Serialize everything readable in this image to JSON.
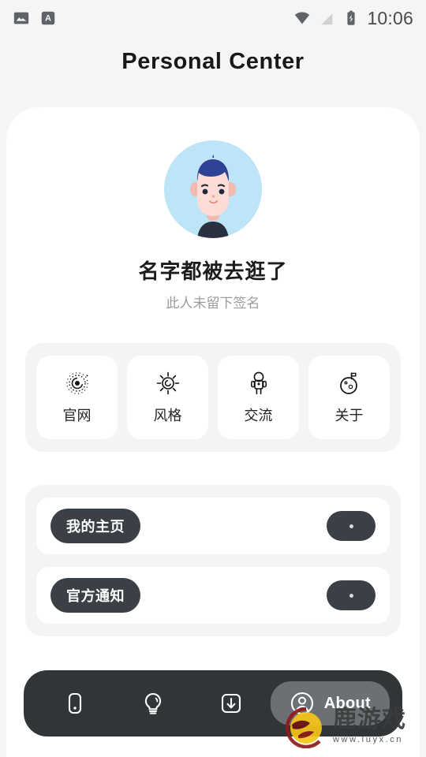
{
  "status_bar": {
    "left_icons": [
      "image-icon",
      "app-a-icon"
    ],
    "right_icons": [
      "wifi-icon",
      "signal-off-icon",
      "battery-charging-icon"
    ],
    "time": "10:06"
  },
  "header": {
    "title": "Personal Center"
  },
  "profile": {
    "avatar_icon": "cartoon-boy-avatar",
    "avatar_bg": "#bde4f7",
    "name": "名字都被去逛了",
    "signature": "此人未留下签名"
  },
  "quick_grid": {
    "items": [
      {
        "label": "官网",
        "icon": "galaxy-spiral-icon"
      },
      {
        "label": "风格",
        "icon": "sun-spiral-icon"
      },
      {
        "label": "交流",
        "icon": "astronaut-icon"
      },
      {
        "label": "关于",
        "icon": "planet-flag-icon"
      }
    ]
  },
  "list_panel": {
    "rows": [
      {
        "label": "我的主页",
        "action_icon": "dot-icon"
      },
      {
        "label": "官方通知",
        "action_icon": "dot-icon"
      }
    ]
  },
  "bottom_nav": {
    "items": [
      {
        "label": "",
        "icon": "device-icon",
        "active": false
      },
      {
        "label": "",
        "icon": "lightbulb-icon",
        "active": false
      },
      {
        "label": "",
        "icon": "download-icon",
        "active": false
      },
      {
        "label": "About",
        "icon": "user-circle-icon",
        "active": true
      }
    ],
    "active_bg": "#6c7074",
    "bar_bg": "#313538"
  },
  "watermark": {
    "brand": "鹿游戏",
    "url": "www.luyx.cn"
  },
  "colors": {
    "page_bg": "#f5f5f6",
    "card_bg": "#ffffff",
    "panel_bg": "#f4f4f5",
    "dark": "#3a4045",
    "text": "#1b1c1e",
    "muted": "#9b9c9e"
  }
}
